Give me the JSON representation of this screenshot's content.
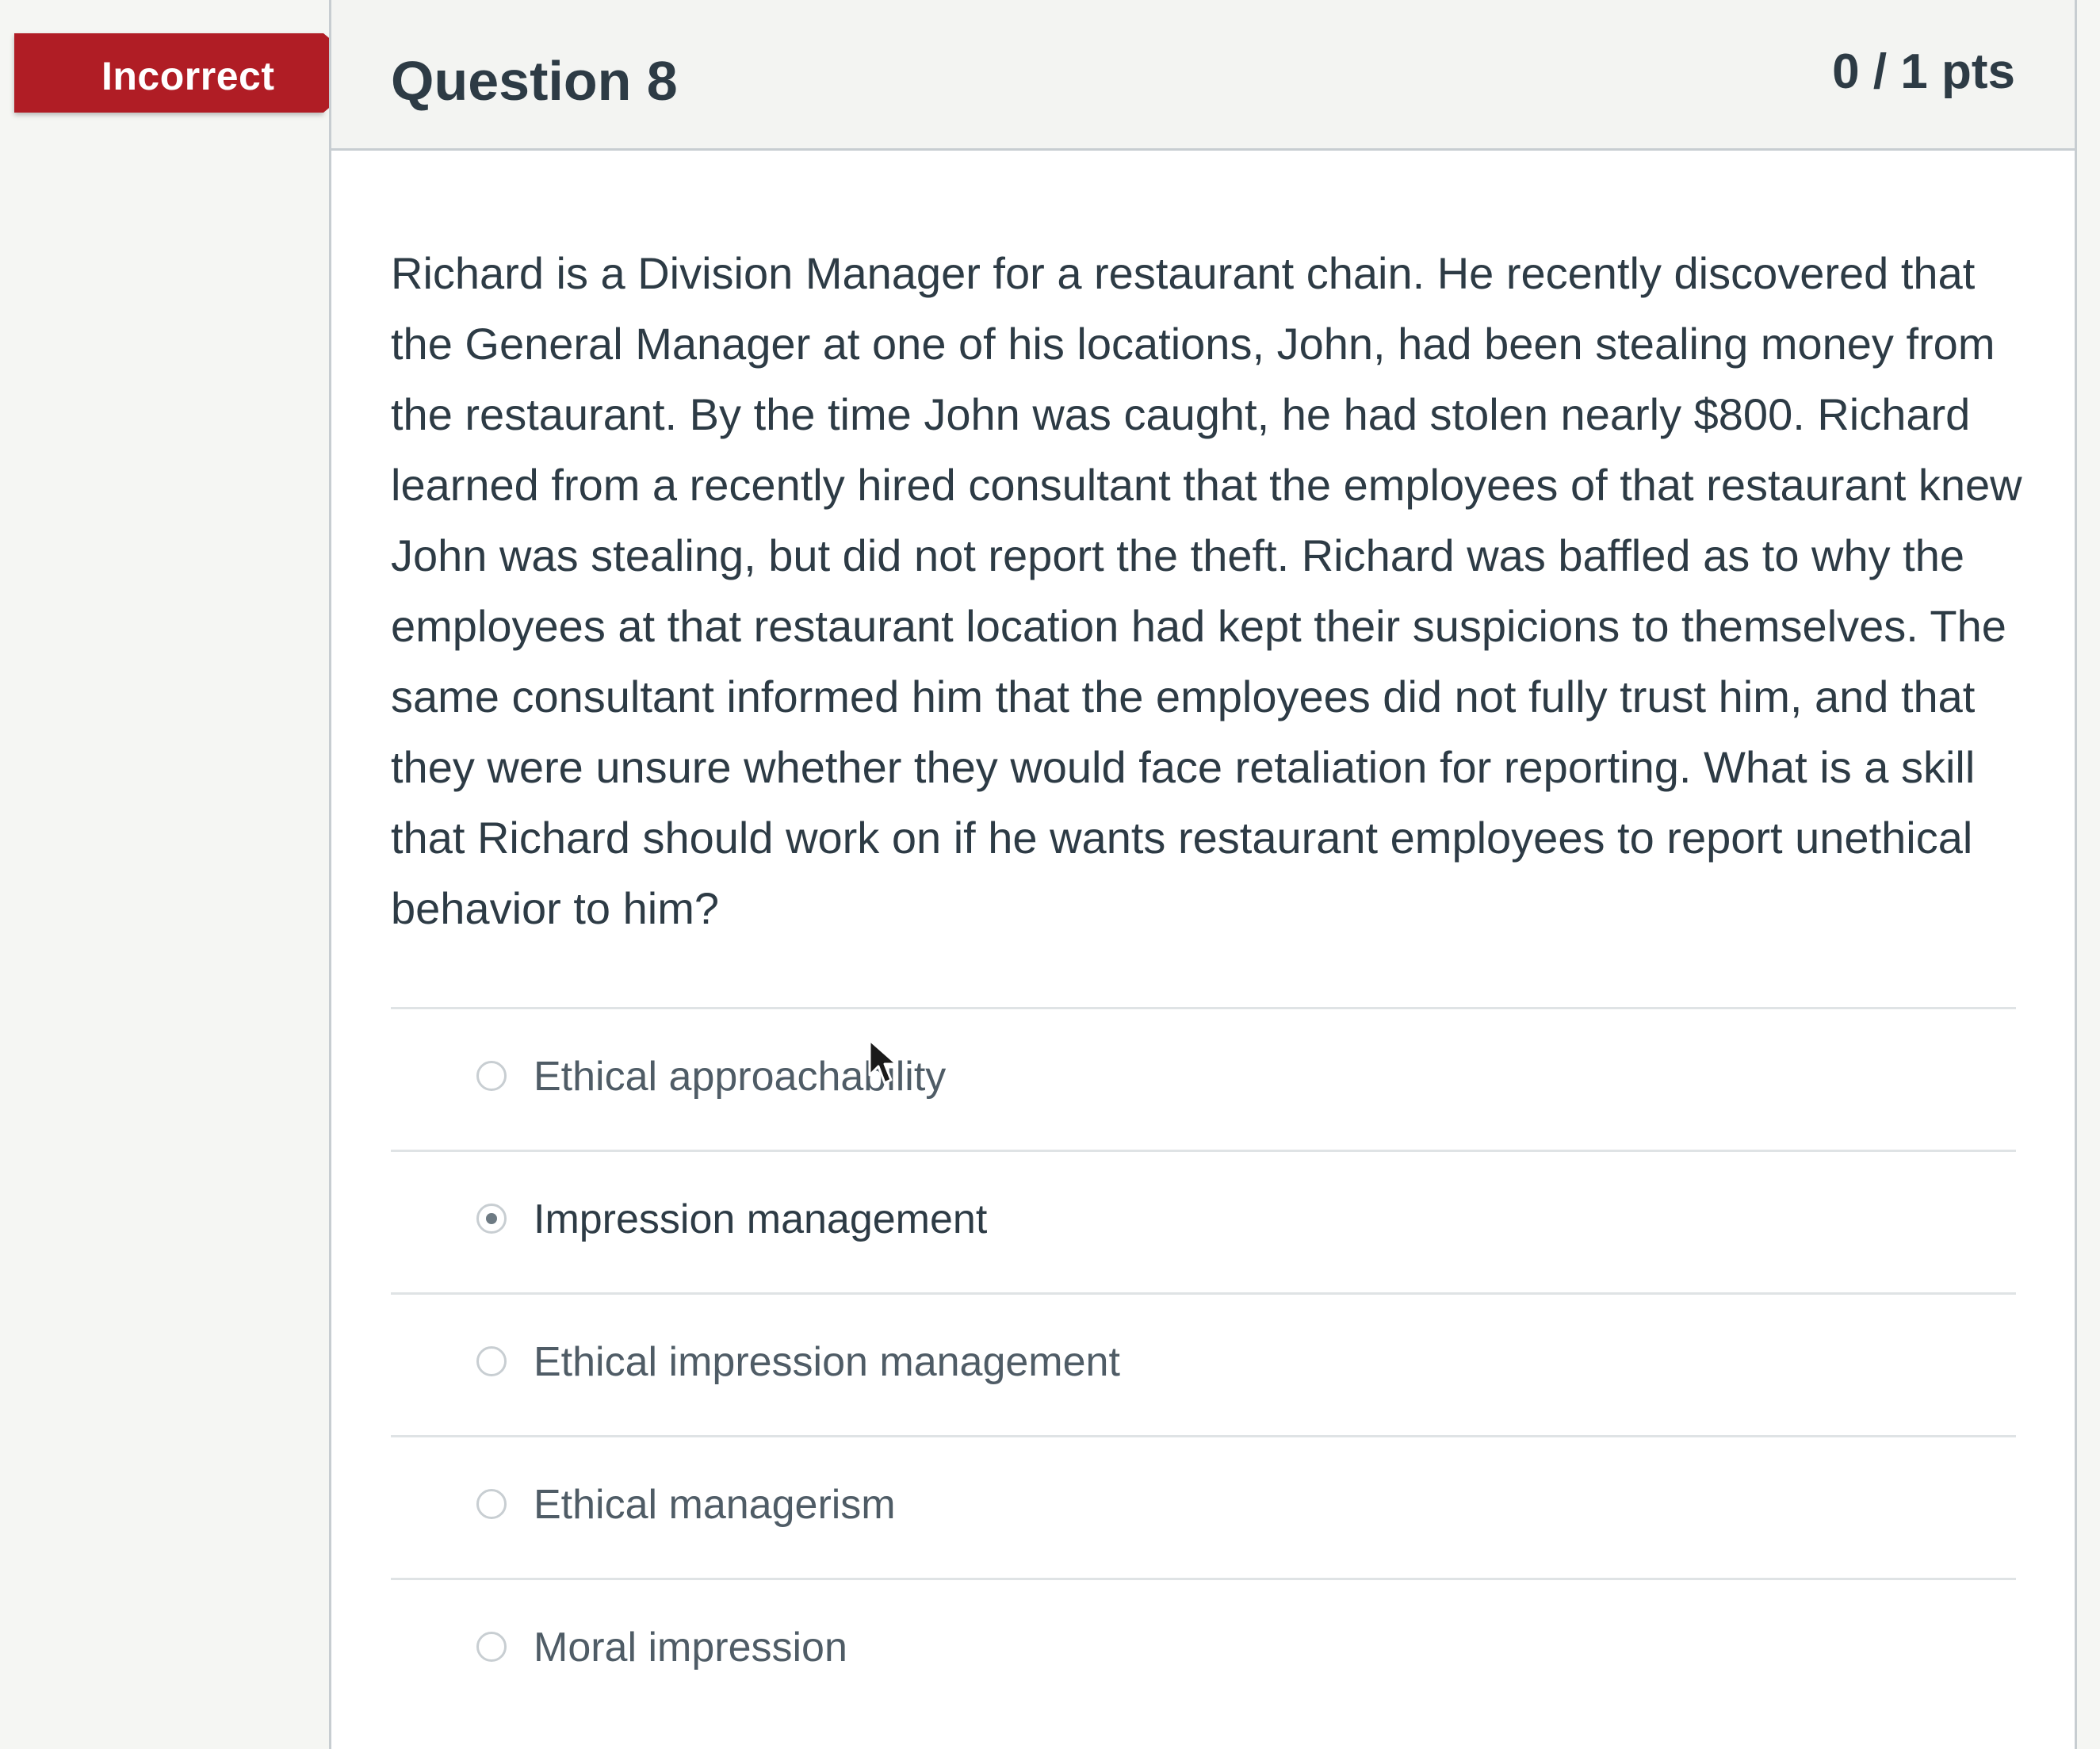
{
  "status_tag": {
    "label": "Incorrect",
    "color": "#b01d25"
  },
  "question": {
    "title": "Question 8",
    "points": "0 / 1 pts",
    "text": "Richard is a Division Manager for a restaurant chain. He recently discovered that the General Manager at one of his locations, John, had been stealing money from the restaurant. By the time John was caught, he had stolen nearly $800. Richard learned from a recently hired consultant that the employees of that restaurant knew John was stealing, but did not report the theft. Richard was baffled as to why the employees at that restaurant location had kept their suspicions to themselves. The same consultant informed him that the employees did not fully trust him, and that they were unsure whether they would face retaliation for reporting. What is a skill that Richard should work on if he wants restaurant employees to report unethical behavior to him?"
  },
  "answers": [
    {
      "label": "Ethical approachability",
      "selected": false
    },
    {
      "label": "Impression management",
      "selected": true
    },
    {
      "label": "Ethical impression management",
      "selected": false
    },
    {
      "label": "Ethical managerism",
      "selected": false
    },
    {
      "label": "Moral impression",
      "selected": false
    }
  ]
}
